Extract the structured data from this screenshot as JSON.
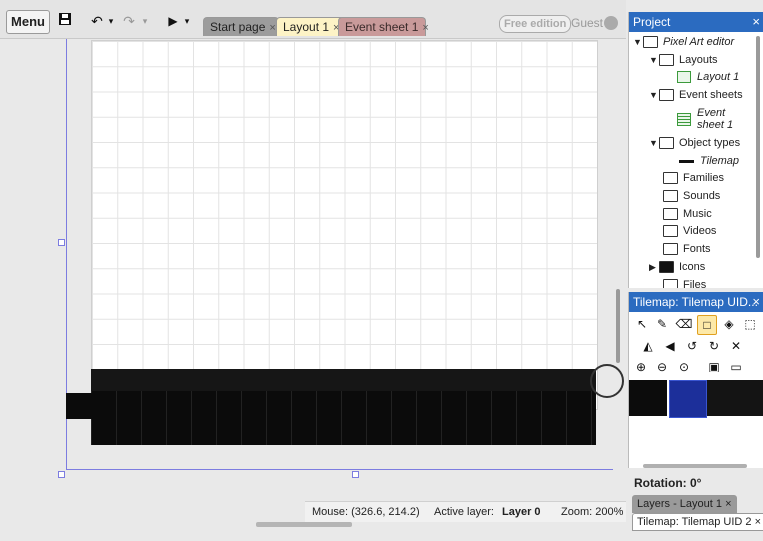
{
  "toolbar": {
    "menu_label": "Menu",
    "save_icon": "save-icon",
    "undo_icon": "undo-icon",
    "redo_icon": "redo-icon",
    "play_icon": "play-icon",
    "dropdown_glyph": "▾"
  },
  "tabs": [
    {
      "label": "Start page",
      "close": "×"
    },
    {
      "label": "Layout 1",
      "close": "×"
    },
    {
      "label": "Event sheet 1",
      "close": "×"
    }
  ],
  "account": {
    "edition_badge": "Free edition",
    "user": "Guest"
  },
  "statusbar": {
    "mouse": "Mouse: (326.6, 214.2)",
    "active_layer_label": "Active layer:",
    "active_layer_value": "Layer 0",
    "zoom": "Zoom: 200%"
  },
  "project_panel": {
    "title": "Project",
    "close": "×",
    "tree": {
      "root": "Pixel Art editor",
      "layouts": "Layouts",
      "layout_1": "Layout 1",
      "event_sheets": "Event sheets",
      "event_sheet_1": "Event sheet 1",
      "object_types": "Object types",
      "tilemap": "Tilemap",
      "families": "Families",
      "sounds": "Sounds",
      "music": "Music",
      "videos": "Videos",
      "fonts": "Fonts",
      "icons": "Icons",
      "files": "Files"
    }
  },
  "tilemap_panel": {
    "title": "Tilemap: Tilemap UID...",
    "close": "×"
  },
  "properties": {
    "rotation": "Rotation: 0°"
  },
  "bottom_tabs": [
    {
      "label": "Layers - Layout 1",
      "close": "×"
    },
    {
      "label": "Tilemap: Tilemap UID 2",
      "close": "×"
    }
  ],
  "colors": {
    "panel_header": "#2b6bc0",
    "layout_border": "#7c7ce0",
    "selected_tool": "#fde9a8"
  }
}
